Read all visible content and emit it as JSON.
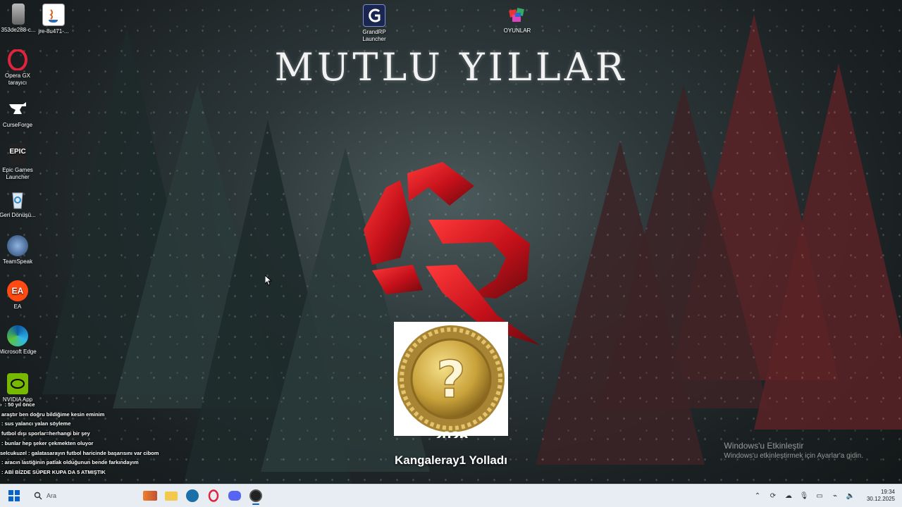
{
  "desktop": {
    "greeting": "MUTLU YILLAR",
    "icons": [
      {
        "label": "353de288-c...",
        "icon": "file-icon"
      },
      {
        "label": "jre-8u471-...",
        "icon": "java-installer-icon"
      },
      {
        "label": "Opera GX tarayıcı",
        "icon": "opera-gx-icon"
      },
      {
        "label": "CurseForge",
        "icon": "curseforge-icon"
      },
      {
        "label": "Epic Games Launcher",
        "icon": "epic-games-icon"
      },
      {
        "label": "Geri Dönüşü...",
        "icon": "recycle-bin-icon"
      },
      {
        "label": "TeamSpeak",
        "icon": "teamspeak-icon"
      },
      {
        "label": "EA",
        "icon": "ea-icon"
      },
      {
        "label": "Microsoft Edge",
        "icon": "edge-icon"
      },
      {
        "label": "NVIDIA App",
        "icon": "nvidia-icon"
      },
      {
        "label": "GrandRP Launcher",
        "icon": "grandrp-icon"
      },
      {
        "label": "OYUNLAR",
        "icon": "games-folder-icon"
      }
    ]
  },
  "overlay": {
    "badge_year": "2026",
    "badge_caption": "Kangaleray1 Yolladı",
    "chat": [
      {
        "user": "",
        "text": ": 50 yıl önce"
      },
      {
        "user": "",
        "text": " araştır ben doğru bildiğime kesin eminim"
      },
      {
        "user": "",
        "text": ": sus yalancı yalan söyleme"
      },
      {
        "user": "",
        "text": "futbol dışı sporlar=herhangi bir şey"
      },
      {
        "user": "",
        "text": ": bunlar hep şeker çekmekten oluyor"
      },
      {
        "user": "selcukuzel",
        "text": ": galatasarayın futbol haricinde başarısını var cibom"
      },
      {
        "user": "",
        "text": ": aracın lastiğinin patlak olduğunun bende farkındayım"
      },
      {
        "user": "",
        "text": ": ABİ BİZDE SÜPER KUPA DA 5 ATMIŞTIK"
      }
    ]
  },
  "watermark": {
    "title": "Windows'u Etkinleştir",
    "subtitle": "Windows'u etkinleştirmek için Ayarlar'a gidin."
  },
  "taskbar": {
    "search_placeholder": "Ara",
    "time": "19:34",
    "date": "30.12.2025"
  },
  "colors": {
    "accent_red": "#d3141c",
    "taskbar_bg": "#e8edf3",
    "badge_gold": "#c9a23a"
  }
}
